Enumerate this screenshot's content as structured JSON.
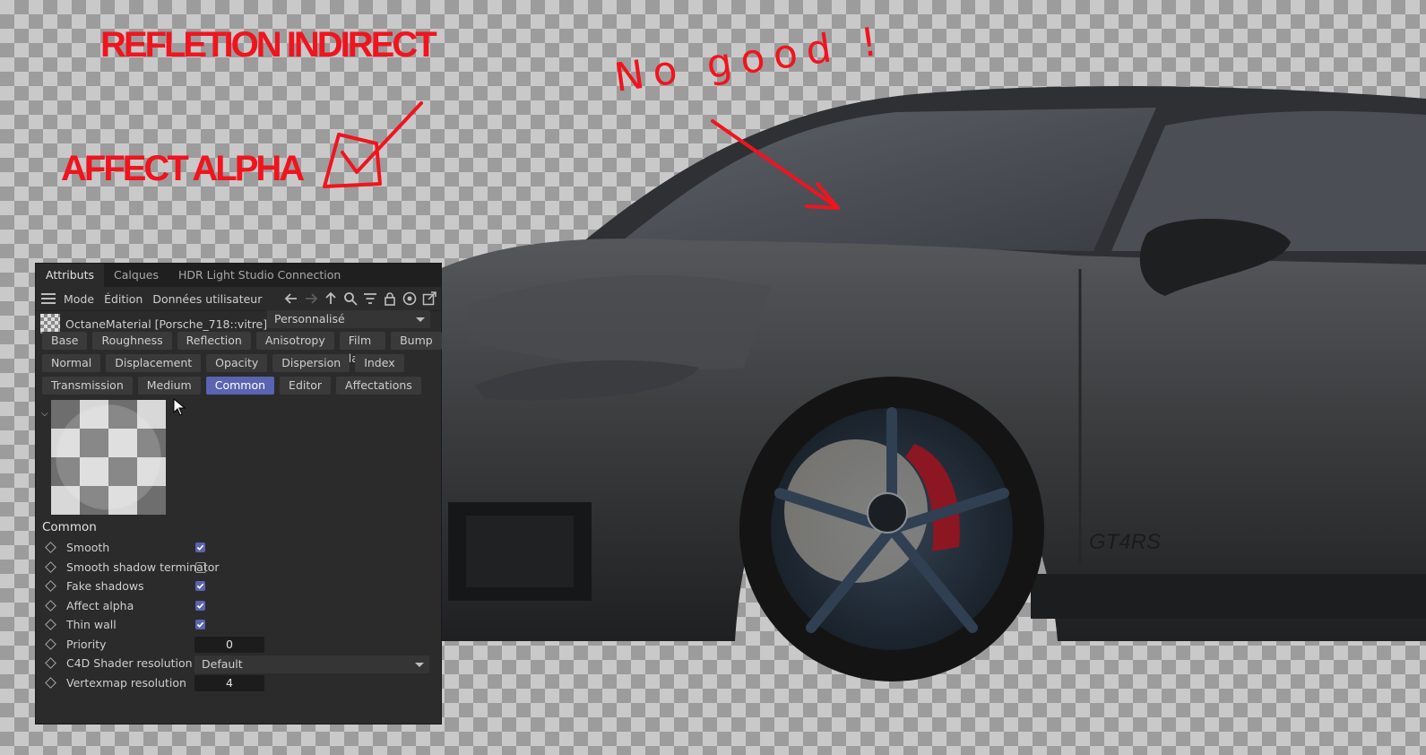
{
  "annotations": {
    "refletion_label": "REFLETION INDIRECT",
    "affect_alpha_label": "AFFECT ALPHA",
    "handwriting": "No good !",
    "color": "#f0141e"
  },
  "car": {
    "badge_text": "GT4RS"
  },
  "panel": {
    "tabs": [
      {
        "label": "Attributs",
        "active": true
      },
      {
        "label": "Calques",
        "active": false
      },
      {
        "label": "HDR Light Studio Connection",
        "active": false
      }
    ],
    "menu": [
      "Mode",
      "Édition",
      "Données utilisateur"
    ],
    "toolbar_icons": [
      "arrow-left-icon",
      "arrow-right-icon",
      "arrow-up-icon",
      "search-icon",
      "filter-icon",
      "lock-icon",
      "target-icon",
      "external-icon"
    ],
    "material_name": "OctaneMaterial [Porsche_718::vitre]",
    "preset": "Personnalisé",
    "channel_rows": [
      [
        "Base",
        "Roughness",
        "Reflection",
        "Anisotropy",
        "Film layer",
        "Bump"
      ],
      [
        "Normal",
        "Displacement",
        "Opacity",
        "Dispersion",
        "Index"
      ],
      [
        "Transmission",
        "Medium",
        "Common",
        "Editor",
        "Affectations"
      ]
    ],
    "active_channel": "Common",
    "accent_color": "#5a64b0",
    "section_title": "Common",
    "properties": [
      {
        "label": "Smooth",
        "type": "checkbox",
        "checked": true
      },
      {
        "label": "Smooth shadow terminator",
        "type": "checkbox",
        "checked": false
      },
      {
        "label": "Fake shadows",
        "type": "checkbox",
        "checked": true
      },
      {
        "label": "Affect alpha",
        "type": "checkbox",
        "checked": true
      },
      {
        "label": "Thin wall",
        "type": "checkbox",
        "checked": true
      },
      {
        "label": "Priority",
        "type": "number",
        "value": "0"
      },
      {
        "label": "C4D Shader resolution",
        "type": "select",
        "value": "Default"
      },
      {
        "label": "Vertexmap resolution",
        "type": "number",
        "value": "4"
      }
    ]
  }
}
